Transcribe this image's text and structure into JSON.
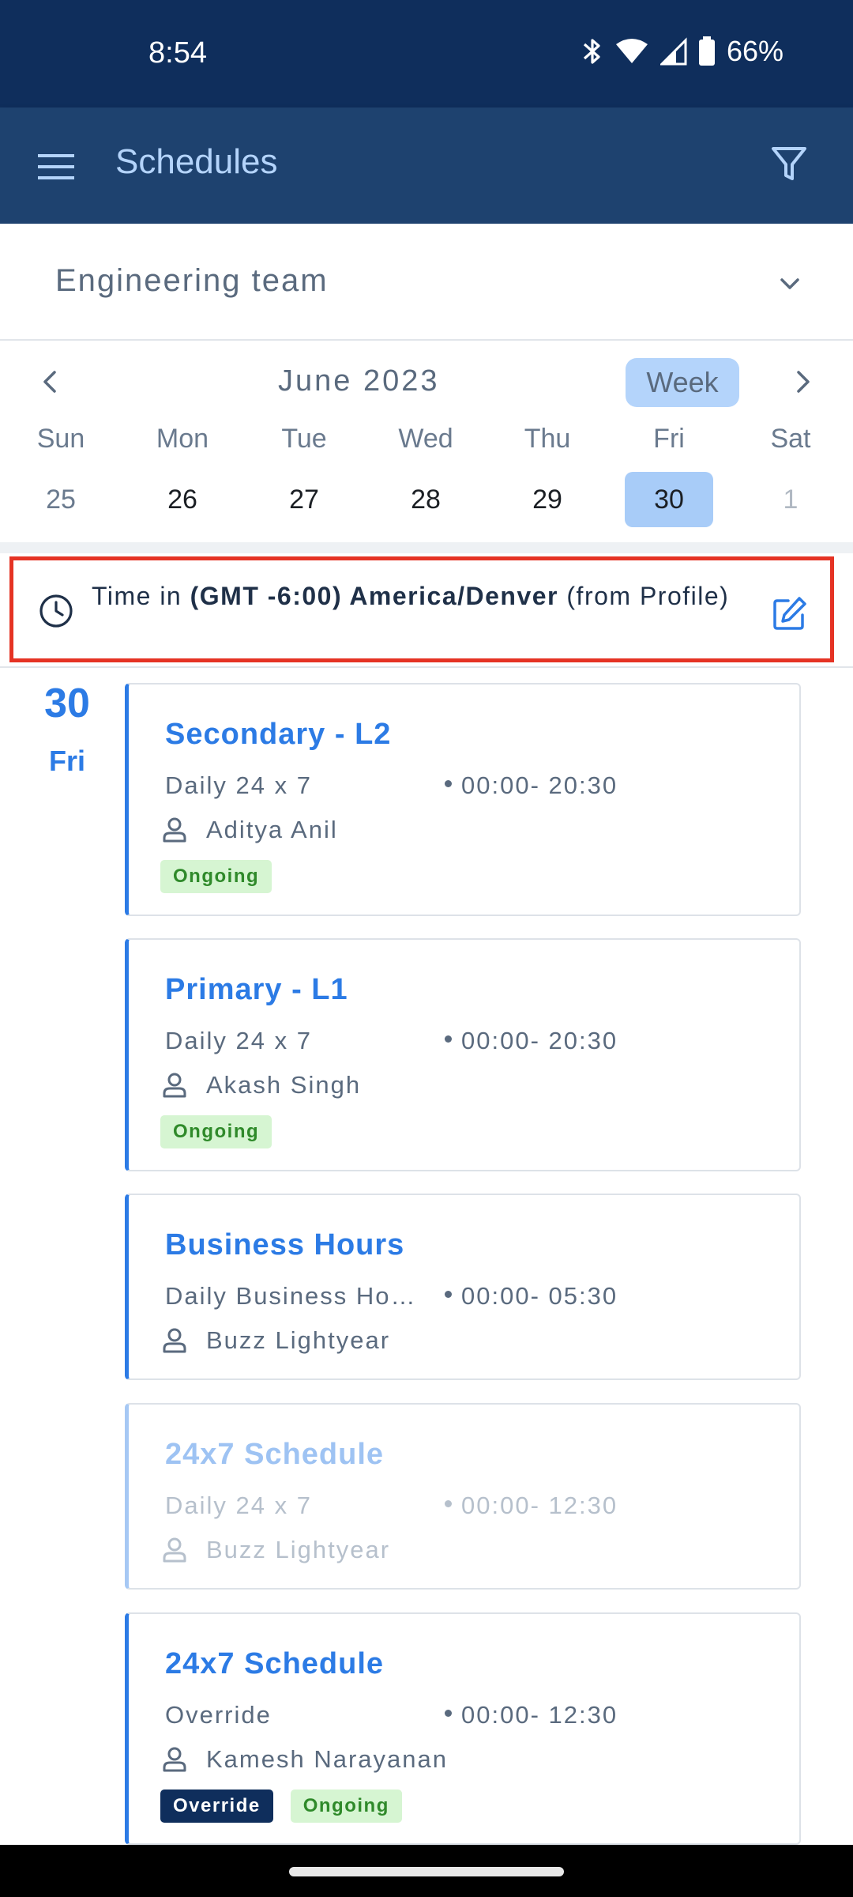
{
  "status_bar": {
    "time": "8:54",
    "battery": "66%"
  },
  "app_bar": {
    "title": "Schedules"
  },
  "team_selector": {
    "value": "Engineering team"
  },
  "calendar": {
    "month": "June 2023",
    "view_button": "Week",
    "days": [
      {
        "name": "Sun",
        "num": "25"
      },
      {
        "name": "Mon",
        "num": "26"
      },
      {
        "name": "Tue",
        "num": "27"
      },
      {
        "name": "Wed",
        "num": "28"
      },
      {
        "name": "Thu",
        "num": "29"
      },
      {
        "name": "Fri",
        "num": "30"
      },
      {
        "name": "Sat",
        "num": "1"
      }
    ],
    "selected_day": "30"
  },
  "timezone": {
    "prefix": "Time in ",
    "zone": "(GMT -6:00) America/Denver",
    "suffix": " (from Profile)"
  },
  "date_marker": {
    "day_number": "30",
    "day_name": "Fri"
  },
  "schedules": [
    {
      "title": "Secondary - L2",
      "type": "Daily 24 x 7",
      "time": "00:00- 20:30",
      "person": "Aditya Anil",
      "badges": [
        "Ongoing"
      ]
    },
    {
      "title": "Primary - L1",
      "type": "Daily 24 x 7",
      "time": "00:00- 20:30",
      "person": "Akash Singh",
      "badges": [
        "Ongoing"
      ]
    },
    {
      "title": "Business Hours",
      "type": "Daily Business Hours",
      "time": "00:00- 05:30",
      "person": "Buzz  Lightyear",
      "badges": []
    },
    {
      "title": "24x7 Schedule",
      "type": "Daily 24 x 7",
      "time": "00:00- 12:30",
      "person": "Buzz  Lightyear",
      "badges": []
    },
    {
      "title": "24x7 Schedule",
      "type": "Override",
      "time": "00:00- 12:30",
      "person": "Kamesh Narayanan",
      "badges": [
        "Override",
        "Ongoing"
      ]
    }
  ],
  "colors": {
    "status_bar_bg": "#0f2e5c",
    "app_bar_bg": "#1e426f",
    "accent_blue": "#2c7be5",
    "highlight_red": "#e53324",
    "ongoing_badge_bg": "#d6f5d2",
    "override_badge_bg": "#0f2e5c"
  }
}
